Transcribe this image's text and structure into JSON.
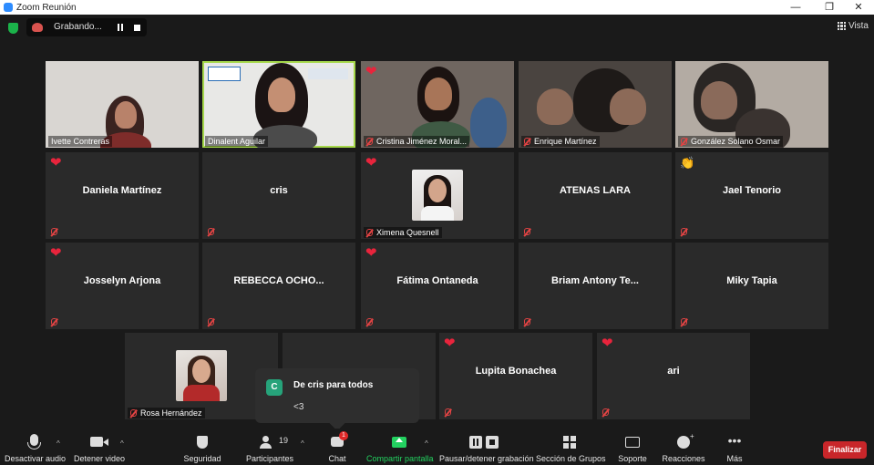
{
  "window": {
    "title": "Zoom Reunión",
    "minimize": "—",
    "maximize": "❐",
    "close": "✕"
  },
  "topbar": {
    "recording_label": "Grabando...",
    "view_label": "Vista"
  },
  "tiles": {
    "ivette": {
      "label": "Ivette Contreras"
    },
    "dinalent": {
      "label": "Dinalent Aguilar"
    },
    "cristina": {
      "label": "Cristina Jiménez Moral..."
    },
    "enrique": {
      "label": "Enrique Martínez"
    },
    "osmar": {
      "label": "González Solano Osmar"
    },
    "daniela": {
      "name": "Daniela Martínez"
    },
    "cris": {
      "name": "cris"
    },
    "ximena": {
      "label": "Ximena Quesnell"
    },
    "atenas": {
      "name": "ATENAS LARA"
    },
    "jael": {
      "name": "Jael Tenorio"
    },
    "josselyn": {
      "name": "Josselyn Arjona"
    },
    "rebecca": {
      "name": "REBECCA  OCHO..."
    },
    "fatima": {
      "name": "Fátima Ontaneda"
    },
    "briam": {
      "name": "Briam  Antony  Te..."
    },
    "miky": {
      "name": "Miky Tapia"
    },
    "rosa": {
      "label": "Rosa Hernández"
    },
    "lupita": {
      "name": "Lupita Bonachea"
    },
    "ari": {
      "name": "ari"
    }
  },
  "reactions": {
    "heart": "❤",
    "clap": "👏"
  },
  "chat_popup": {
    "avatar": "C",
    "from": "De cris para todos",
    "message": "<3"
  },
  "toolbar": {
    "mute": "Desactivar audio",
    "video": "Detener video",
    "security": "Seguridad",
    "participants": "Participantes",
    "participants_count": "19",
    "chat": "Chat",
    "chat_badge": "1",
    "share": "Compartir pantalla",
    "pause_record": "Pausar/detener grabación",
    "breakout": "Sección de Grupos",
    "support": "Soporte",
    "reactions": "Reacciones",
    "more": "Más",
    "end": "Finalizar"
  },
  "colors": {
    "accent_green": "#23d160",
    "active_speaker": "#a6d84b",
    "end_red": "#c8262a",
    "heart_red": "#e8243c"
  }
}
